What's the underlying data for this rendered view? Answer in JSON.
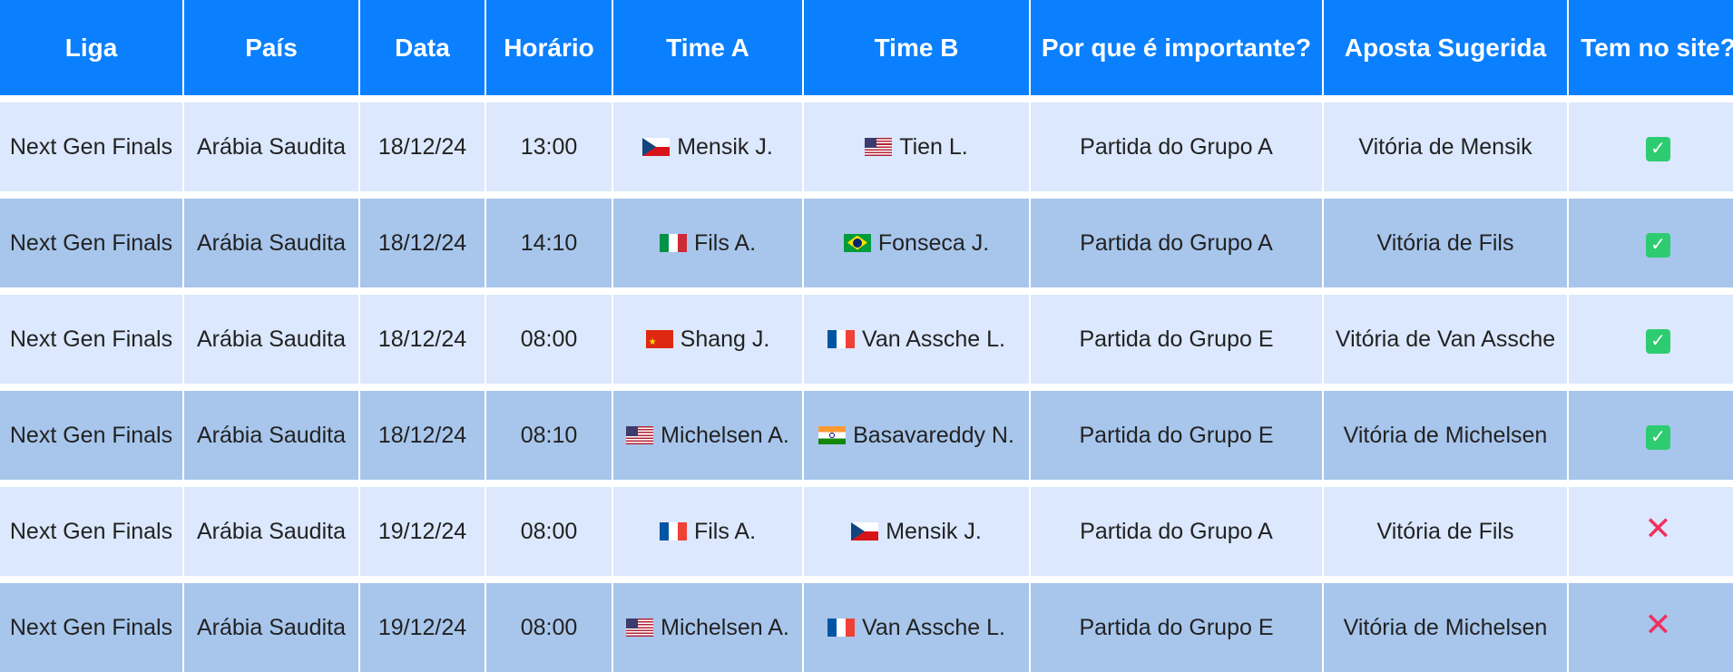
{
  "headers": [
    "Liga",
    "País",
    "Data",
    "Horário",
    "Time A",
    "Time B",
    "Por que é importante?",
    "Aposta Sugerida",
    "Tem no site?"
  ],
  "rows": [
    {
      "liga": "Next Gen Finals",
      "pais": "Arábia Saudita",
      "data": "18/12/24",
      "horario": "13:00",
      "time_a": {
        "flag": "cz-flag-icon",
        "name": "Mensik J."
      },
      "time_b": {
        "flag": "us-flag-icon",
        "name": "Tien L."
      },
      "motivo": "Partida do Grupo A",
      "aposta": "Vitória de Mensik",
      "no_site": true
    },
    {
      "liga": "Next Gen Finals",
      "pais": "Arábia Saudita",
      "data": "18/12/24",
      "horario": "14:10",
      "time_a": {
        "flag": "it-flag-icon",
        "name": "Fils A."
      },
      "time_b": {
        "flag": "br-flag-icon",
        "name": "Fonseca J."
      },
      "motivo": "Partida do Grupo A",
      "aposta": "Vitória de Fils",
      "no_site": true
    },
    {
      "liga": "Next Gen Finals",
      "pais": "Arábia Saudita",
      "data": "18/12/24",
      "horario": "08:00",
      "time_a": {
        "flag": "cn-flag-icon",
        "name": "Shang J."
      },
      "time_b": {
        "flag": "fr-flag-icon",
        "name": "Van Assche L."
      },
      "motivo": "Partida do Grupo E",
      "aposta": "Vitória de Van Assche",
      "no_site": true
    },
    {
      "liga": "Next Gen Finals",
      "pais": "Arábia Saudita",
      "data": "18/12/24",
      "horario": "08:10",
      "time_a": {
        "flag": "us-flag-icon",
        "name": "Michelsen A."
      },
      "time_b": {
        "flag": "in-flag-icon",
        "name": "Basavareddy N."
      },
      "motivo": "Partida do Grupo E",
      "aposta": "Vitória de Michelsen",
      "no_site": true
    },
    {
      "liga": "Next Gen Finals",
      "pais": "Arábia Saudita",
      "data": "19/12/24",
      "horario": "08:00",
      "time_a": {
        "flag": "fr-flag-icon",
        "name": "Fils A."
      },
      "time_b": {
        "flag": "cz-flag-icon",
        "name": "Mensik J."
      },
      "motivo": "Partida do Grupo A",
      "aposta": "Vitória de Fils",
      "no_site": false
    },
    {
      "liga": "Next Gen Finals",
      "pais": "Arábia Saudita",
      "data": "19/12/24",
      "horario": "08:00",
      "time_a": {
        "flag": "us-flag-icon",
        "name": "Michelsen A."
      },
      "time_b": {
        "flag": "fr-flag-icon",
        "name": "Van Assche L."
      },
      "motivo": "Partida do Grupo E",
      "aposta": "Vitória de Michelsen",
      "no_site": false
    }
  ],
  "icons": {
    "yes": "check-icon",
    "no": "cross-icon"
  },
  "colors": {
    "header_bg": "#0a80ff",
    "row_light": "#dbe8fd",
    "row_dark": "#a8c6ec",
    "check": "#2ecc71",
    "cross": "#f0305f"
  }
}
